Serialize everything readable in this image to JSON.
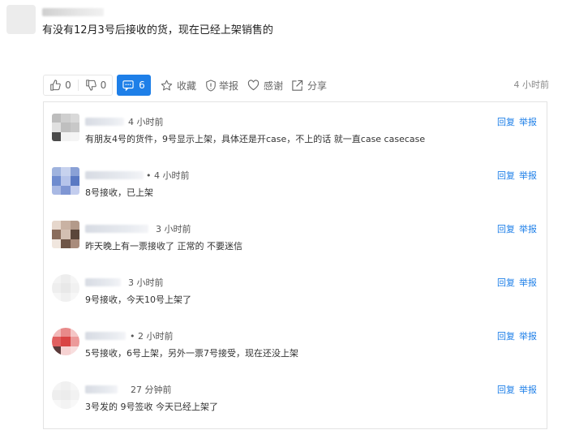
{
  "post": {
    "text": "有没有12月3号后接收的货，现在已经上架销售的"
  },
  "actions": {
    "like_count": "0",
    "dislike_count": "0",
    "comment_count": "6",
    "favorite_label": "收藏",
    "report_label": "举报",
    "thanks_label": "感谢",
    "share_label": "分享",
    "time": "4 小时前"
  },
  "colors": {
    "accent": "#1e7fe8",
    "border": "#e3e3e3"
  },
  "comments": [
    {
      "time": "4 小时前",
      "text": "有朋友4号的货件，9号显示上架，具体还是开case，不上的话 就一直case casecase",
      "reply": "回复",
      "report": "举报"
    },
    {
      "time": "• 4 小时前",
      "text": "8号接收，已上架",
      "reply": "回复",
      "report": "举报"
    },
    {
      "time": "3 小时前",
      "text": "昨天晚上有一票接收了 正常的 不要迷信",
      "reply": "回复",
      "report": "举报"
    },
    {
      "time": "3 小时前",
      "text": "9号接收，今天10号上架了",
      "reply": "回复",
      "report": "举报"
    },
    {
      "time": "• 2 小时前",
      "text": "5号接收，6号上架，另外一票7号接受，现在还没上架",
      "reply": "回复",
      "report": "举报"
    },
    {
      "time": "27 分钟前",
      "text": "3号发的 9号签收 今天已经上架了",
      "reply": "回复",
      "report": "举报"
    }
  ]
}
